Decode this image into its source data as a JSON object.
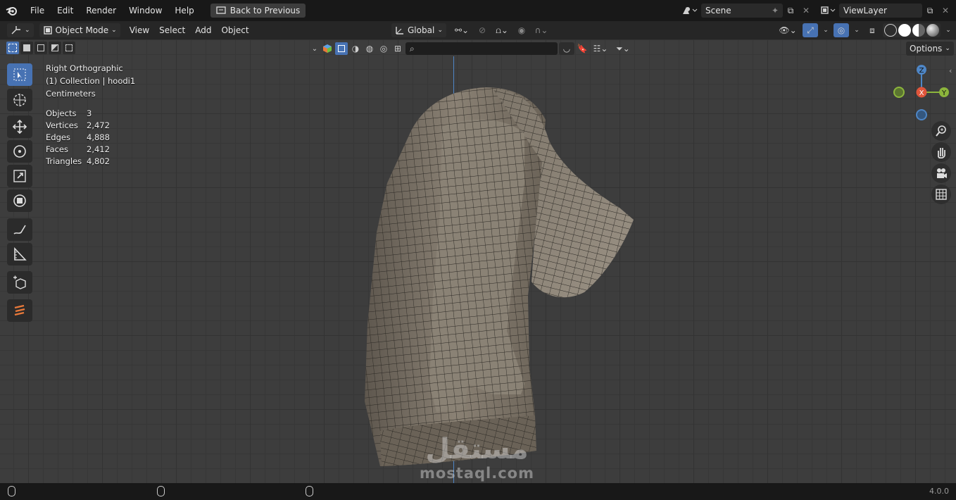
{
  "topbar": {
    "menu": [
      "File",
      "Edit",
      "Render",
      "Window",
      "Help"
    ],
    "back_button": "Back to Previous",
    "scene": "Scene",
    "view_layer": "ViewLayer"
  },
  "header": {
    "mode": "Object Mode",
    "menus": [
      "View",
      "Select",
      "Add",
      "Object"
    ],
    "transform_orientation": "Global"
  },
  "subheader": {
    "options_label": "Options",
    "search_value": ""
  },
  "overlay": {
    "view_name": "Right Orthographic",
    "collection": "(1) Collection | hoodi1",
    "units": "Centimeters",
    "stats": [
      {
        "label": "Objects",
        "value": "3"
      },
      {
        "label": "Vertices",
        "value": "2,472"
      },
      {
        "label": "Edges",
        "value": "4,888"
      },
      {
        "label": "Faces",
        "value": "2,412"
      },
      {
        "label": "Triangles",
        "value": "4,802"
      }
    ]
  },
  "gizmo": {
    "x": "X",
    "y": "Y",
    "z": "Z"
  },
  "status": {
    "version": "4.0.0"
  },
  "watermark": {
    "arabic": "مستقل",
    "latin": "mostaql.com"
  },
  "colors": {
    "accent": "#4772b3",
    "x_axis": "#e0553b",
    "y_axis": "#8cb53c",
    "z_axis": "#4e86c6"
  },
  "tools": [
    "select-box-icon",
    "cursor-icon",
    "move-icon",
    "rotate-icon",
    "scale-icon",
    "transform-icon",
    "annotate-icon",
    "measure-icon",
    "add-cube-icon",
    "grease-pencil-icon"
  ]
}
